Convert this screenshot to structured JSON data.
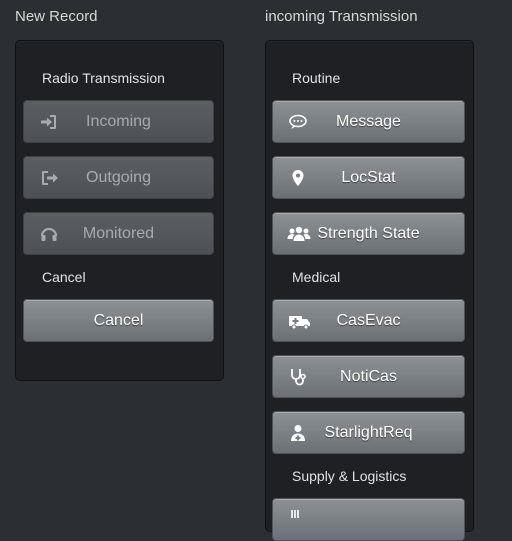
{
  "left": {
    "title": "New Record",
    "section_label": "Radio Transmission",
    "buttons": [
      {
        "label": "Incoming",
        "icon": "sign-in-icon"
      },
      {
        "label": "Outgoing",
        "icon": "sign-out-icon"
      },
      {
        "label": "Monitored",
        "icon": "headphones-icon"
      }
    ],
    "cancel_label": "Cancel",
    "cancel_button": "Cancel"
  },
  "right": {
    "title": "incoming Transmission",
    "routine_label": "Routine",
    "routine_buttons": [
      {
        "label": "Message",
        "icon": "comment-icon"
      },
      {
        "label": "LocStat",
        "icon": "map-marker-icon"
      },
      {
        "label": "Strength State",
        "icon": "group-icon"
      }
    ],
    "medical_label": "Medical",
    "medical_buttons": [
      {
        "label": "CasEvac",
        "icon": "ambulance-icon"
      },
      {
        "label": "NotiCas",
        "icon": "stethoscope-icon"
      },
      {
        "label": "StarlightReq",
        "icon": "user-md-icon"
      }
    ],
    "supply_label": "Supply & Logistics"
  },
  "colors": {
    "background": "#2b2e32",
    "panel": "#1e2023",
    "button_active": "#7c8186",
    "button_disabled": "#54585d"
  }
}
